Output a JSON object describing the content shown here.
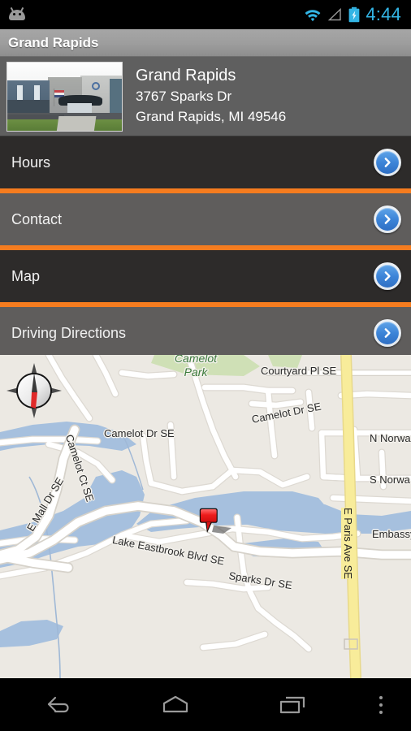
{
  "statusbar": {
    "notification_icon": "android-robot-icon",
    "wifi_icon": "wifi-icon",
    "signal_icon": "cell-signal-icon",
    "battery_icon": "battery-charging-icon",
    "clock": "4:44",
    "accent_color": "#33b5e5"
  },
  "titlebar": {
    "title": "Grand Rapids"
  },
  "header": {
    "photo_alt": "store-photo",
    "name": "Grand Rapids",
    "address_line1": "3767 Sparks Dr",
    "address_line2": "Grand Rapids, MI 49546"
  },
  "list": {
    "divider_color": "#f57c1f",
    "items": [
      {
        "label": "Hours",
        "chevron": "chevron-right-icon"
      },
      {
        "label": "Contact",
        "chevron": "chevron-right-icon"
      },
      {
        "label": "Map",
        "chevron": "chevron-right-icon"
      },
      {
        "label": "Driving Directions",
        "chevron": "chevron-right-icon"
      }
    ]
  },
  "map": {
    "compass_icon": "compass-rose-icon",
    "marker_icon": "map-marker-icon",
    "base_color": "#ece9e3",
    "water_color": "#a6c0de",
    "highway_color": "#f8ec9a",
    "park_color": "#cfe0b6",
    "labels": [
      {
        "text": "Camelot\nPark",
        "kind": "park"
      },
      {
        "text": "Courtyard Pl SE",
        "kind": "street"
      },
      {
        "text": "Camelot Dr SE",
        "kind": "street"
      },
      {
        "text": "Camelot Dr SE",
        "kind": "street"
      },
      {
        "text": "Camelot Ct SE",
        "kind": "street"
      },
      {
        "text": "N Norwa",
        "kind": "street"
      },
      {
        "text": "S Norwa",
        "kind": "street"
      },
      {
        "text": "Embassy",
        "kind": "street"
      },
      {
        "text": "E Mall Dr SE",
        "kind": "street"
      },
      {
        "text": "Lake Eastbrook Blvd SE",
        "kind": "street"
      },
      {
        "text": "Sparks Dr SE",
        "kind": "street"
      },
      {
        "text": "E Paris Ave SE",
        "kind": "highway"
      }
    ],
    "label_camelot_park_line1": "Camelot",
    "label_camelot_park_line2": "Park",
    "label_courtyard": "Courtyard Pl SE",
    "label_camelot_dr_left": "Camelot Dr SE",
    "label_camelot_dr_right": "Camelot Dr SE",
    "label_camelot_ct": "Camelot Ct SE",
    "label_n_norway": "N Norwa",
    "label_s_norway": "S Norwa",
    "label_embassy": "Embassy",
    "label_e_mall": "E Mall Dr SE",
    "label_lake_eastbrook": "Lake Eastbrook Blvd SE",
    "label_sparks": "Sparks Dr SE",
    "label_e_paris": "E Paris Ave SE"
  },
  "navbar": {
    "back": "back-icon",
    "home": "home-icon",
    "recents": "recent-apps-icon",
    "overflow": "overflow-menu-icon"
  }
}
